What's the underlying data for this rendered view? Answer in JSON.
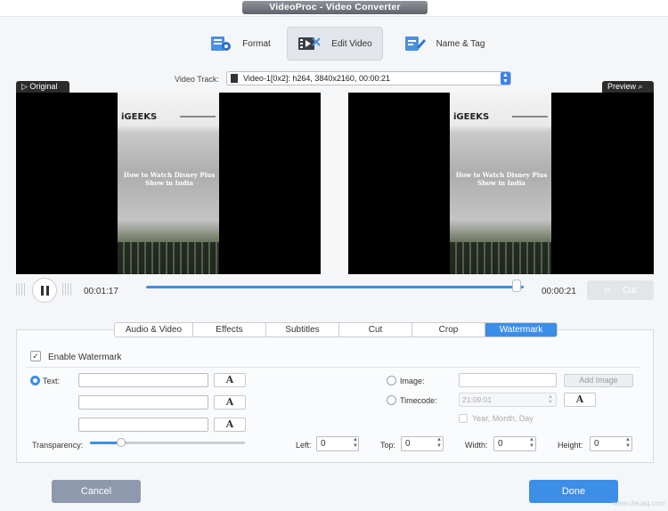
{
  "window": {
    "title": "VideoProc - Video Converter"
  },
  "nav": {
    "tabs": [
      {
        "label": "Format",
        "icon": "format-icon"
      },
      {
        "label": "Edit Video",
        "icon": "edit-video-icon",
        "active": true
      },
      {
        "label": "Name & Tag",
        "icon": "name-tag-icon"
      }
    ]
  },
  "video_track": {
    "label": "Video Track:",
    "value": "Video-1[0x2]: h264, 3840x2160, 00:00:21"
  },
  "panels": {
    "original_label": "Original",
    "preview_label": "Preview"
  },
  "clip": {
    "site_logo": "iGEEKS",
    "headline": "How to Watch Disney Plus Show in India"
  },
  "transport": {
    "current_time": "00:01:17",
    "end_time": "00:00:21",
    "cut_label": "Cut",
    "progress": 0.98
  },
  "edit_tabs": [
    {
      "label": "Audio & Video"
    },
    {
      "label": "Effects"
    },
    {
      "label": "Subtitles"
    },
    {
      "label": "Cut"
    },
    {
      "label": "Crop"
    },
    {
      "label": "Watermark",
      "active": true
    }
  ],
  "watermark": {
    "enable_label": "Enable Watermark",
    "enabled": true,
    "text_label": "Text:",
    "font_button_glyph": "A",
    "image_label": "Image:",
    "add_image_label": "Add Image",
    "timecode_label": "Timecode:",
    "timecode_value": "21:09:01",
    "ymd_label": "Year, Month, Day",
    "transparency_label": "Transparency:",
    "transparency_value": 0.2,
    "left_label": "Left:",
    "left_value": "0",
    "top_label": "Top:",
    "top_value": "0",
    "width_label": "Width:",
    "width_value": "0",
    "height_label": "Height:",
    "height_value": "0"
  },
  "footer": {
    "cancel_label": "Cancel",
    "done_label": "Done",
    "site_watermark": "www.deuaq.com"
  },
  "colors": {
    "accent": "#3b8ee8",
    "cancel": "#8e99ad",
    "done": "#3d8ee6"
  }
}
